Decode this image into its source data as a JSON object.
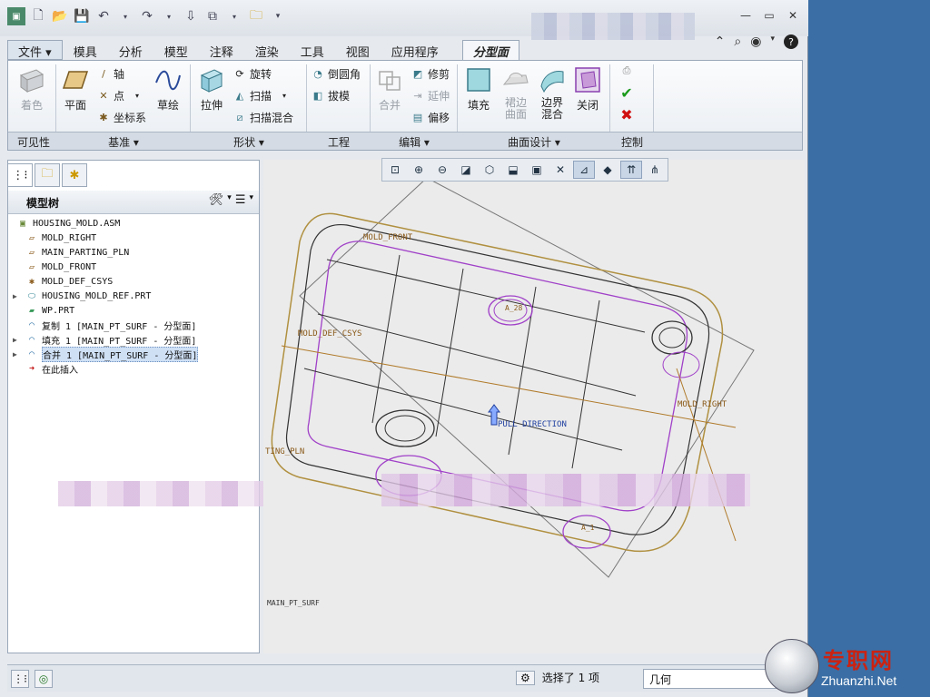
{
  "menu": {
    "file": "文件",
    "items": [
      "模具",
      "分析",
      "模型",
      "注释",
      "渲染",
      "工具",
      "视图",
      "应用程序"
    ],
    "active_tab": "分型面"
  },
  "ribbon": {
    "visibility": {
      "shading": "着色",
      "group": "可见性"
    },
    "datum": {
      "plane": "平面",
      "axis": "轴",
      "point": "点",
      "csys": "坐标系",
      "sketch": "草绘",
      "group": "基准"
    },
    "shapes": {
      "extrude": "拉伸",
      "revolve": "旋转",
      "sweep": "扫描",
      "swept_blend": "扫描混合",
      "group": "形状"
    },
    "engineering": {
      "round": "倒圆角",
      "draft": "拔模",
      "group": "工程"
    },
    "editing": {
      "merge": "合并",
      "trim": "修剪",
      "extend": "延伸",
      "offset": "偏移",
      "group": "编辑"
    },
    "surface_design": {
      "fill": "填充",
      "skirt": "裙边曲面",
      "boundary": "边界混合",
      "close": "关闭",
      "group": "曲面设计"
    },
    "control": {
      "group": "控制"
    }
  },
  "model_tree": {
    "title": "模型树",
    "items": [
      {
        "label": "HOUSING_MOLD.ASM",
        "icon": "assembly-icon",
        "expandable": false,
        "indent": 0
      },
      {
        "label": "MOLD_RIGHT",
        "icon": "datum-plane-icon",
        "expandable": false,
        "indent": 1
      },
      {
        "label": "MAIN_PARTING_PLN",
        "icon": "datum-plane-icon",
        "expandable": false,
        "indent": 1
      },
      {
        "label": "MOLD_FRONT",
        "icon": "datum-plane-icon",
        "expandable": false,
        "indent": 1
      },
      {
        "label": "MOLD_DEF_CSYS",
        "icon": "csys-icon",
        "expandable": false,
        "indent": 1
      },
      {
        "label": "HOUSING_MOLD_REF.PRT",
        "icon": "part-icon",
        "expandable": true,
        "indent": 1
      },
      {
        "label": "WP.PRT",
        "icon": "workpiece-icon",
        "expandable": false,
        "indent": 1
      },
      {
        "label": "复制 1 [MAIN_PT_SURF - 分型面]",
        "icon": "surface-copy-icon",
        "expandable": false,
        "indent": 1
      },
      {
        "label": "填充 1 [MAIN_PT_SURF - 分型面]",
        "icon": "surface-fill-icon",
        "expandable": true,
        "indent": 1
      },
      {
        "label": "合并 1 [MAIN_PT_SURF - 分型面]",
        "icon": "surface-merge-icon",
        "expandable": true,
        "indent": 1,
        "selected": true
      },
      {
        "label": "在此插入",
        "icon": "insert-here-arrow-icon",
        "expandable": false,
        "indent": 1
      }
    ]
  },
  "viewport": {
    "labels": {
      "mold_front": "MOLD_FRONT",
      "mold_right": "MOLD_RIGHT",
      "def_csys": "MOLD_DEF_CSYS",
      "parting_pln": "TING_PLN",
      "pull_direction": "PULL DIRECTION",
      "a28": "A_28",
      "a1": "A_1"
    },
    "bottom_label": "MAIN_PT_SURF"
  },
  "status": {
    "selection": "选择了 1 项",
    "filter": "几何"
  },
  "watermark": {
    "cn": "专职网",
    "en": "Zhuanzhi.Net"
  },
  "colors": {
    "accent": "#3a6ea5",
    "model_edges": "#3a3a3a",
    "parting_surface": "#a040c8",
    "datum": "#b07a2a"
  }
}
